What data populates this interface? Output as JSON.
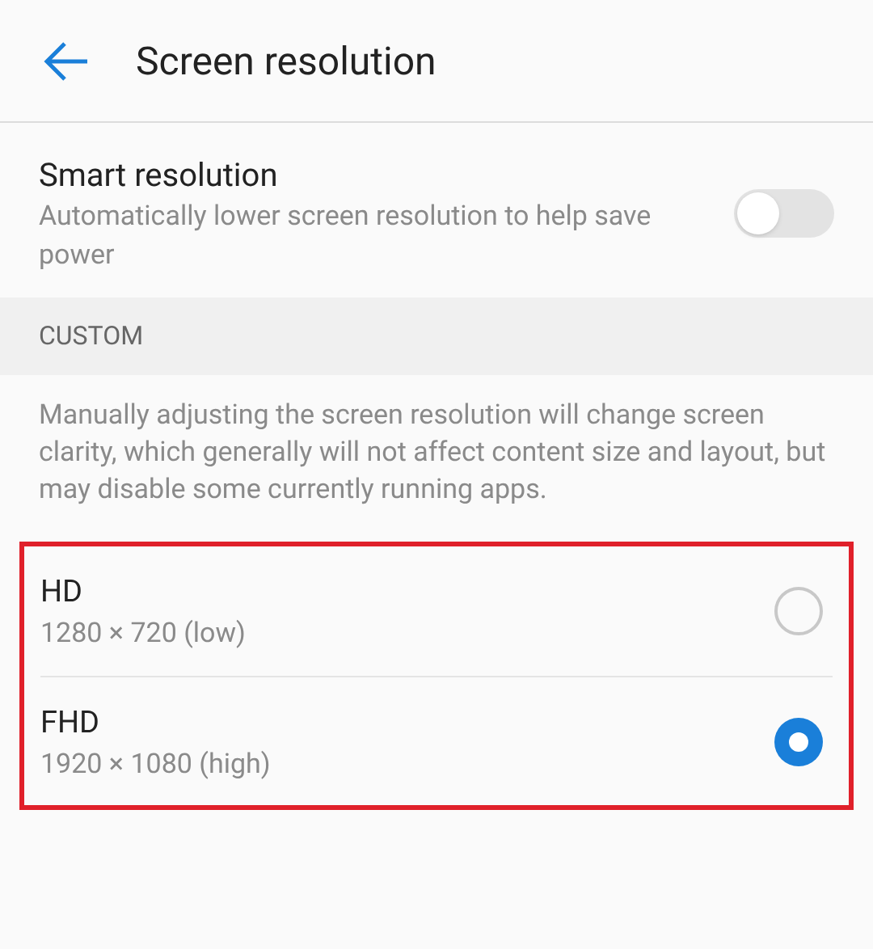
{
  "header": {
    "title": "Screen resolution"
  },
  "smart_resolution": {
    "title": "Smart resolution",
    "description": "Automatically lower screen resolution to help save power",
    "on": false
  },
  "section": {
    "title": "CUSTOM",
    "description": "Manually adjusting the screen resolution will change screen clarity, which generally will not affect content size and layout, but may disable some currently running apps."
  },
  "options": [
    {
      "title": "HD",
      "subtitle": "1280 × 720 (low)",
      "selected": false
    },
    {
      "title": "FHD",
      "subtitle": "1920 × 1080 (high)",
      "selected": true
    }
  ]
}
